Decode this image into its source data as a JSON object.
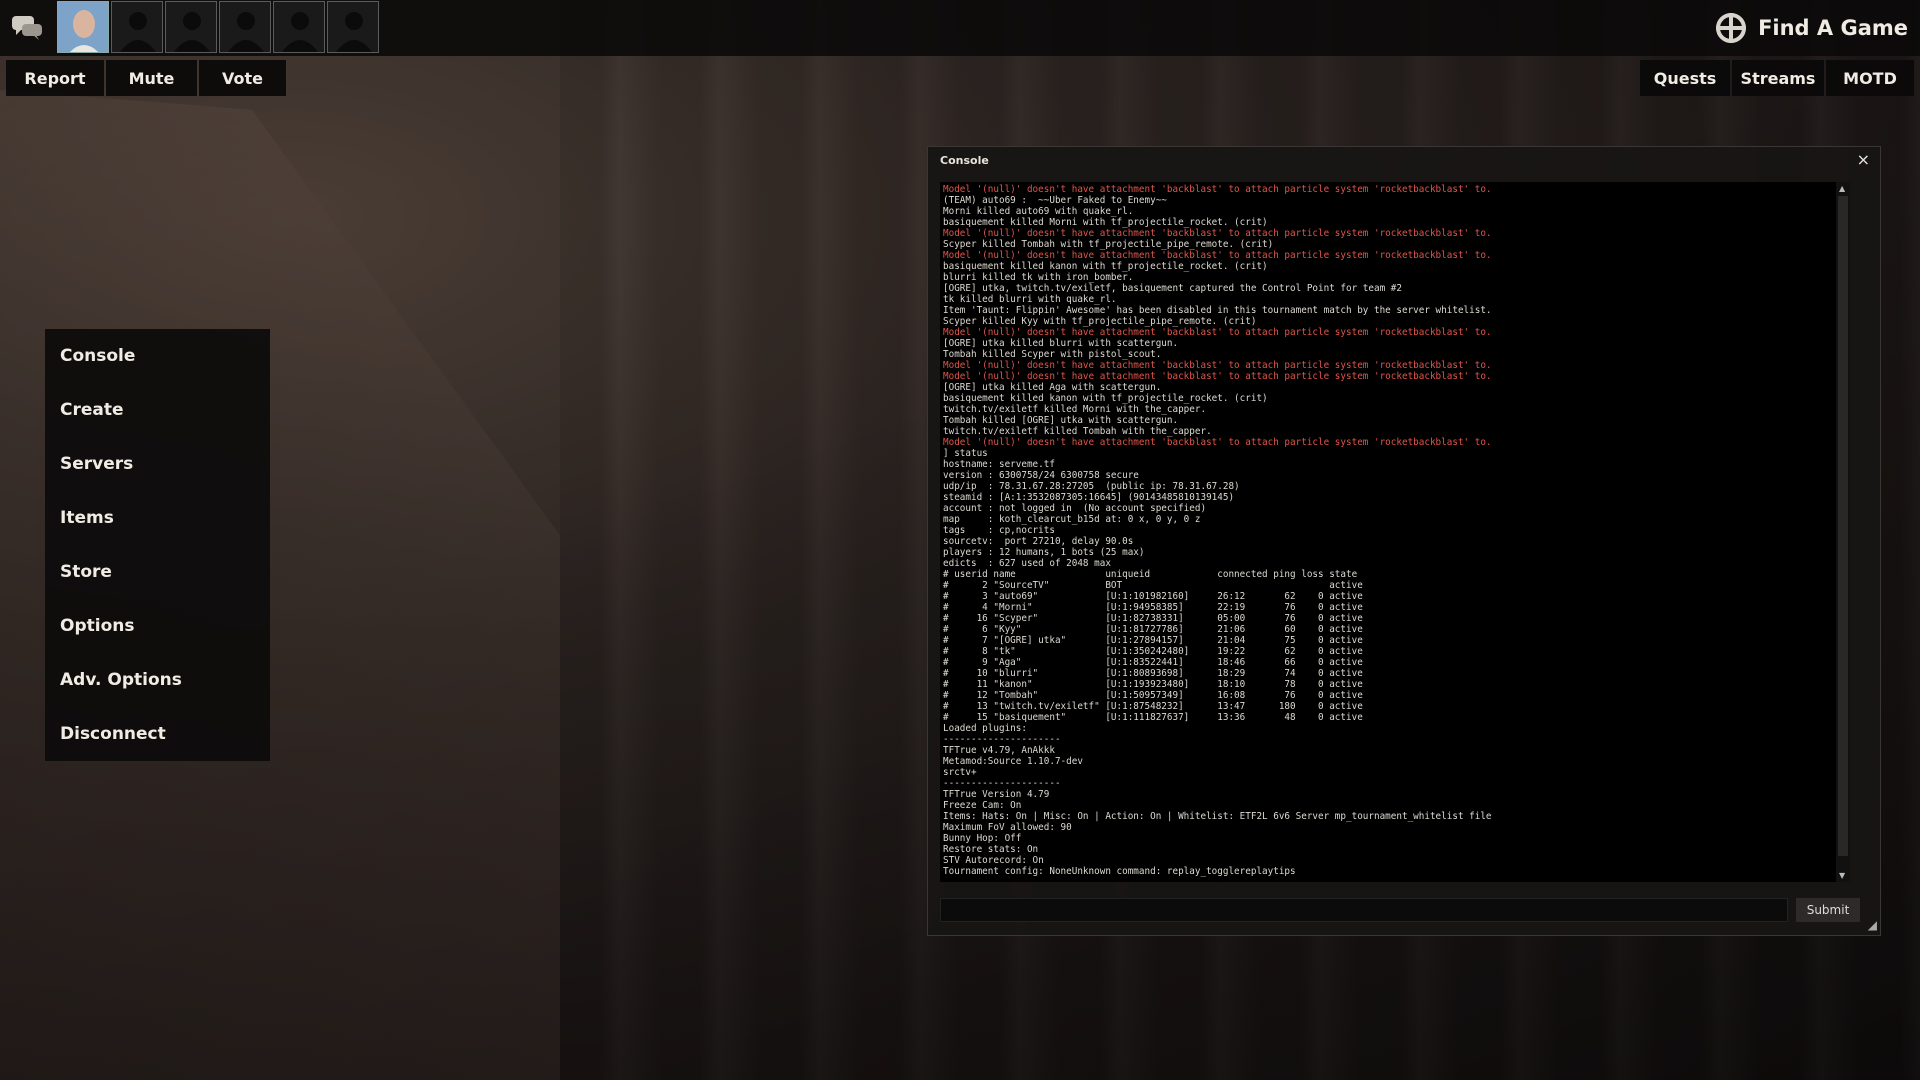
{
  "topbar": {
    "avatars": [
      "player",
      "empty",
      "empty",
      "empty",
      "empty",
      "empty"
    ],
    "find_game": "Find A Game"
  },
  "left_buttons": [
    "Report",
    "Mute",
    "Vote"
  ],
  "right_buttons": [
    "Quests",
    "Streams",
    "MOTD"
  ],
  "menu": [
    "Console",
    "Create",
    "Servers",
    "Items",
    "Store",
    "Options",
    "Adv. Options",
    "Disconnect"
  ],
  "console": {
    "title": "Console",
    "close": "×",
    "submit_label": "Submit",
    "input_value": "",
    "error_color": "#e0554a",
    "lines": [
      {
        "text": "Model '(null)' doesn't have attachment 'backblast' to attach particle system 'rocketbackblast' to.",
        "err": true
      },
      {
        "text": "(TEAM) auto69 :  ~~Uber Faked to Enemy~~",
        "err": false
      },
      {
        "text": "Morni killed auto69 with quake_rl.",
        "err": false
      },
      {
        "text": "basiquement killed Morni with tf_projectile_rocket. (crit)",
        "err": false
      },
      {
        "text": "Model '(null)' doesn't have attachment 'backblast' to attach particle system 'rocketbackblast' to.",
        "err": true
      },
      {
        "text": "Scyper killed Tombah with tf_projectile_pipe_remote. (crit)",
        "err": false
      },
      {
        "text": "Model '(null)' doesn't have attachment 'backblast' to attach particle system 'rocketbackblast' to.",
        "err": true
      },
      {
        "text": "basiquement killed kanon with tf_projectile_rocket. (crit)",
        "err": false
      },
      {
        "text": "blurri killed tk with iron_bomber.",
        "err": false
      },
      {
        "text": "[OGRE] utka, twitch.tv/exiletf, basiquement captured the Control Point for team #2",
        "err": false
      },
      {
        "text": "tk killed blurri with quake_rl.",
        "err": false
      },
      {
        "text": "Item 'Taunt: Flippin' Awesome' has been disabled in this tournament match by the server whitelist.",
        "err": false
      },
      {
        "text": "Scyper killed Kyy with tf_projectile_pipe_remote. (crit)",
        "err": false
      },
      {
        "text": "Model '(null)' doesn't have attachment 'backblast' to attach particle system 'rocketbackblast' to.",
        "err": true
      },
      {
        "text": "[OGRE] utka killed blurri with scattergun.",
        "err": false
      },
      {
        "text": "Tombah killed Scyper with pistol_scout.",
        "err": false
      },
      {
        "text": "Model '(null)' doesn't have attachment 'backblast' to attach particle system 'rocketbackblast' to.",
        "err": true
      },
      {
        "text": "Model '(null)' doesn't have attachment 'backblast' to attach particle system 'rocketbackblast' to.",
        "err": true
      },
      {
        "text": "[OGRE] utka killed Aga with scattergun.",
        "err": false
      },
      {
        "text": "basiquement killed kanon with tf_projectile_rocket. (crit)",
        "err": false
      },
      {
        "text": "twitch.tv/exiletf killed Morni with the_capper.",
        "err": false
      },
      {
        "text": "Tombah killed [OGRE] utka with scattergun.",
        "err": false
      },
      {
        "text": "twitch.tv/exiletf killed Tombah with the_capper.",
        "err": false
      },
      {
        "text": "Model '(null)' doesn't have attachment 'backblast' to attach particle system 'rocketbackblast' to.",
        "err": true
      },
      {
        "text": "] status",
        "err": false
      },
      {
        "text": "hostname: serveme.tf",
        "err": false
      },
      {
        "text": "version : 6300758/24 6300758 secure",
        "err": false
      },
      {
        "text": "udp/ip  : 78.31.67.28:27205  (public ip: 78.31.67.28)",
        "err": false
      },
      {
        "text": "steamid : [A:1:3532087305:16645] (90143485810139145)",
        "err": false
      },
      {
        "text": "account : not logged in  (No account specified)",
        "err": false
      },
      {
        "text": "map     : koth_clearcut_b15d at: 0 x, 0 y, 0 z",
        "err": false
      },
      {
        "text": "tags    : cp,nocrits",
        "err": false
      },
      {
        "text": "sourcetv:  port 27210, delay 90.0s",
        "err": false
      },
      {
        "text": "players : 12 humans, 1 bots (25 max)",
        "err": false
      },
      {
        "text": "edicts  : 627 used of 2048 max",
        "err": false
      },
      {
        "text": "# userid name                uniqueid            connected ping loss state",
        "err": false
      },
      {
        "text": "#      2 \"SourceTV\"          BOT                                     active",
        "err": false
      },
      {
        "text": "#      3 \"auto69\"            [U:1:101982160]     26:12       62    0 active",
        "err": false
      },
      {
        "text": "#      4 \"Morni\"             [U:1:94958385]      22:19       76    0 active",
        "err": false
      },
      {
        "text": "#     16 \"Scyper\"            [U:1:82738331]      05:00       76    0 active",
        "err": false
      },
      {
        "text": "#      6 \"Kyy\"               [U:1:81727786]      21:06       60    0 active",
        "err": false
      },
      {
        "text": "#      7 \"[OGRE] utka\"       [U:1:27894157]      21:04       75    0 active",
        "err": false
      },
      {
        "text": "#      8 \"tk\"                [U:1:350242480]     19:22       62    0 active",
        "err": false
      },
      {
        "text": "#      9 \"Aga\"               [U:1:83522441]      18:46       66    0 active",
        "err": false
      },
      {
        "text": "#     10 \"blurri\"            [U:1:80893698]      18:29       74    0 active",
        "err": false
      },
      {
        "text": "#     11 \"kanon\"             [U:1:193923480]     18:10       78    0 active",
        "err": false
      },
      {
        "text": "#     12 \"Tombah\"            [U:1:50957349]      16:08       76    0 active",
        "err": false
      },
      {
        "text": "#     13 \"twitch.tv/exiletf\" [U:1:87548232]      13:47      180    0 active",
        "err": false
      },
      {
        "text": "#     15 \"basiquement\"       [U:1:111827637]     13:36       48    0 active",
        "err": false
      },
      {
        "text": "Loaded plugins:",
        "err": false
      },
      {
        "text": "---------------------",
        "err": false
      },
      {
        "text": "TFTrue v4.79, AnAkkk",
        "err": false
      },
      {
        "text": "Metamod:Source 1.10.7-dev",
        "err": false
      },
      {
        "text": "srctv+",
        "err": false
      },
      {
        "text": "---------------------",
        "err": false
      },
      {
        "text": "TFTrue Version 4.79",
        "err": false
      },
      {
        "text": "Freeze Cam: On",
        "err": false
      },
      {
        "text": "Items: Hats: On | Misc: On | Action: On | Whitelist: ETF2L 6v6 Server mp_tournament_whitelist file",
        "err": false
      },
      {
        "text": "Maximum FoV allowed: 90",
        "err": false
      },
      {
        "text": "Bunny Hop: Off",
        "err": false
      },
      {
        "text": "Restore stats: On",
        "err": false
      },
      {
        "text": "STV Autorecord: On",
        "err": false
      },
      {
        "text": "Tournament config: NoneUnknown command: replay_togglereplaytips",
        "err": false
      }
    ]
  }
}
